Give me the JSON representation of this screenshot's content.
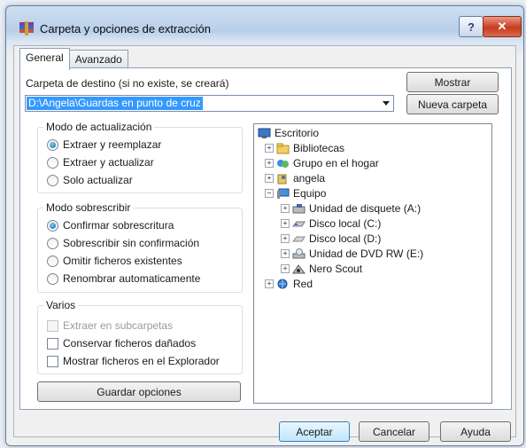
{
  "window": {
    "title": "Carpeta y opciones de extracción",
    "help_glyph": "?",
    "close_glyph": "✕"
  },
  "tabs": [
    {
      "label": "General"
    },
    {
      "label": "Avanzado"
    }
  ],
  "destination": {
    "label": "Carpeta de destino (si no existe, se creará)",
    "value": "D:\\Angela\\Guardas en punto de cruz",
    "show_button": "Mostrar",
    "new_folder_button": "Nueva carpeta"
  },
  "update_mode": {
    "title": "Modo de actualización",
    "options": [
      "Extraer y reemplazar",
      "Extraer y actualizar",
      "Solo actualizar"
    ],
    "selected": "Extraer y reemplazar"
  },
  "overwrite_mode": {
    "title": "Modo sobrescribir",
    "options": [
      "Confirmar sobrescritura",
      "Sobrescribir sin confirmación",
      "Omitir ficheros existentes",
      "Renombrar automaticamente"
    ],
    "selected": "Confirmar sobrescritura"
  },
  "misc": {
    "title": "Varios",
    "options": [
      {
        "label": "Extraer en subcarpetas",
        "checked": false,
        "disabled": true
      },
      {
        "label": "Conservar ficheros dañados",
        "checked": false,
        "disabled": false
      },
      {
        "label": "Mostrar ficheros en el Explorador",
        "checked": false,
        "disabled": false
      }
    ]
  },
  "save_options_button": "Guardar opciones",
  "tree": {
    "root": "Escritorio",
    "items": [
      {
        "label": "Bibliotecas",
        "icon": "libraries-icon"
      },
      {
        "label": "Grupo en el hogar",
        "icon": "homegroup-icon"
      },
      {
        "label": "angela",
        "icon": "user-folder-icon"
      },
      {
        "label": "Equipo",
        "icon": "computer-icon"
      },
      {
        "label": "Unidad de disquete (A:)",
        "icon": "floppy-icon"
      },
      {
        "label": "Disco local (C:)",
        "icon": "hard-disk-icon"
      },
      {
        "label": "Disco local (D:)",
        "icon": "hard-disk-icon"
      },
      {
        "label": "Unidad de DVD RW (E:)",
        "icon": "dvd-drive-icon"
      },
      {
        "label": "Nero Scout",
        "icon": "nero-scout-icon"
      },
      {
        "label": "Red",
        "icon": "network-icon"
      }
    ],
    "expand_glyph": "+",
    "collapse_glyph": "−"
  },
  "footer": {
    "accept": "Aceptar",
    "cancel": "Cancelar",
    "help": "Ayuda"
  },
  "colors": {
    "selection": "#3399ff",
    "accent": "#3c7fb1",
    "close": "#c73b1e"
  }
}
